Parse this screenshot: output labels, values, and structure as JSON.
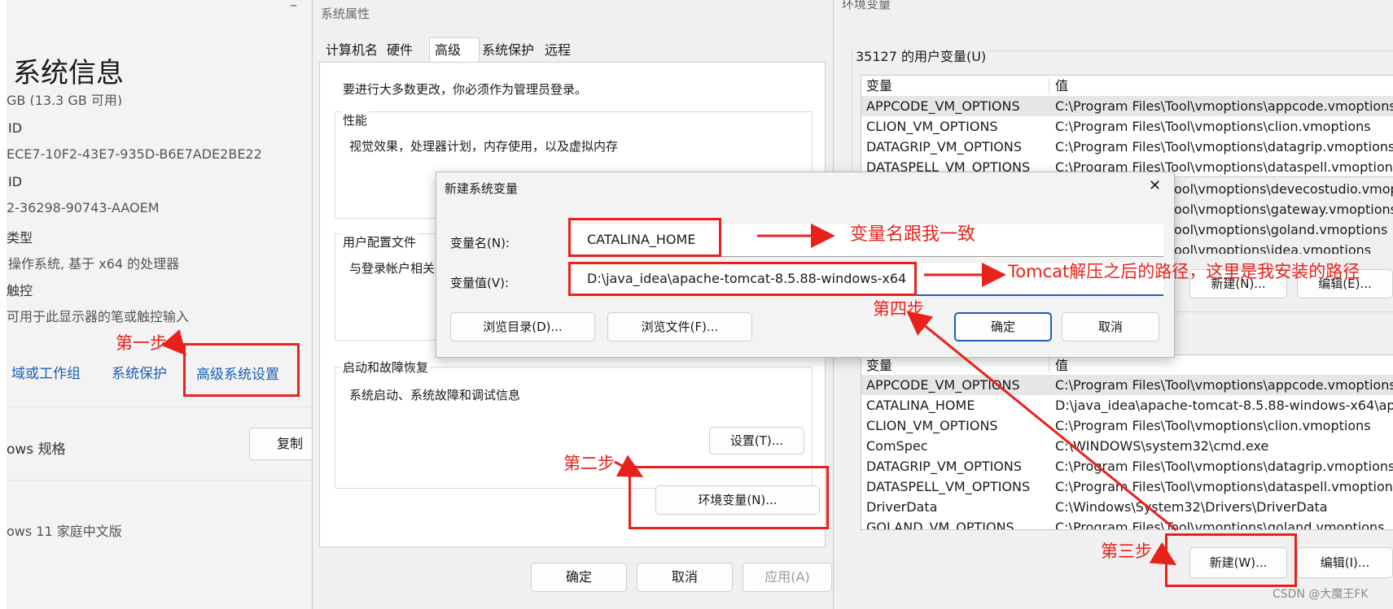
{
  "settings": {
    "title": "系统信息",
    "minimize_glyph": "–",
    "lines": [
      "GB (13.3 GB 可用)",
      "ID",
      "ECE7-10F2-43E7-935D-B6E7ADE2BE22",
      "ID",
      "2-36298-90743-AAOEM",
      "类型",
      "操作系统, 基于 x64 的处理器",
      "触控",
      "可用于此显示器的笔或触控输入"
    ],
    "links": [
      "域或工作组",
      "系统保护",
      "高级系统设置"
    ],
    "spec_label": "ows 规格",
    "copy_button": "复制",
    "edition": "ows 11 家庭中文版"
  },
  "sysprops": {
    "title": "系统属性",
    "tabs": [
      "计算机名",
      "硬件",
      "高级",
      "系统保护",
      "远程"
    ],
    "admin_note": "要进行大多数更改，你必须作为管理员登录。",
    "perf_title": "性能",
    "perf_desc": "视觉效果，处理器计划，内存使用，以及虚拟内存",
    "profile_title": "用户配置文件",
    "profile_desc": "与登录帐户相关",
    "startup_title": "启动和故障恢复",
    "startup_desc": "系统启动、系统故障和调试信息",
    "settings_button": "设置(T)...",
    "env_button": "环境变量(N)...",
    "ok": "确定",
    "cancel": "取消",
    "apply": "应用(A)"
  },
  "envwin": {
    "title": "环境变量",
    "user_vars_title": "35127 的用户变量(U)",
    "col_var": "变量",
    "col_val": "值",
    "user_vars": [
      {
        "name": "APPCODE_VM_OPTIONS",
        "value": "C:\\Program Files\\Tool\\vmoptions\\appcode.vmoptions"
      },
      {
        "name": "CLION_VM_OPTIONS",
        "value": "C:\\Program Files\\Tool\\vmoptions\\clion.vmoptions"
      },
      {
        "name": "DATAGRIP_VM_OPTIONS",
        "value": "C:\\Program Files\\Tool\\vmoptions\\datagrip.vmoptions"
      },
      {
        "name": "DATASPELL_VM_OPTIONS",
        "value": "C:\\Program Files\\Tool\\vmoptions\\dataspell.vmoptions"
      },
      {
        "name": "",
        "value": "ool\\vmoptions\\devecostudio.vmopt"
      },
      {
        "name": "",
        "value": "ool\\vmoptions\\gateway.vmoptions"
      },
      {
        "name": "",
        "value": "ool\\vmoptions\\goland.vmoptions"
      },
      {
        "name": "",
        "value": "ool\\vmoptions\\idea.vmoptions"
      }
    ],
    "user_new": "新建(N)...",
    "user_edit": "编辑(E)...",
    "sys_vars": [
      {
        "name": "APPCODE_VM_OPTIONS",
        "value": "C:\\Program Files\\Tool\\vmoptions\\appcode.vmoptions"
      },
      {
        "name": "CATALINA_HOME",
        "value": "D:\\java_idea\\apache-tomcat-8.5.88-windows-x64\\apa"
      },
      {
        "name": "CLION_VM_OPTIONS",
        "value": "C:\\Program Files\\Tool\\vmoptions\\clion.vmoptions"
      },
      {
        "name": "ComSpec",
        "value": "C:\\WINDOWS\\system32\\cmd.exe"
      },
      {
        "name": "DATAGRIP_VM_OPTIONS",
        "value": "C:\\Program Files\\Tool\\vmoptions\\datagrip.vmoptions"
      },
      {
        "name": "DATASPELL_VM_OPTIONS",
        "value": "C:\\Program Files\\Tool\\vmoptions\\dataspell.vmoptions"
      },
      {
        "name": "DriverData",
        "value": "C:\\Windows\\System32\\Drivers\\DriverData"
      },
      {
        "name": "GOLAND_VM_OPTIONS",
        "value": "C:\\Program Files\\Tool\\vmoptions\\goland.vmoptions"
      }
    ],
    "sys_new": "新建(W)...",
    "sys_edit": "编辑(I)..."
  },
  "dialog": {
    "title": "新建系统变量",
    "close_glyph": "✕",
    "name_label": "变量名(N):",
    "name_value": "CATALINA_HOME",
    "value_label": "变量值(V):",
    "value_value": "D:\\java_idea\\apache-tomcat-8.5.88-windows-x64",
    "browse_dir": "浏览目录(D)...",
    "browse_file": "浏览文件(F)...",
    "ok": "确定",
    "cancel": "取消"
  },
  "annotations": {
    "step1": "第一步",
    "step2": "第二步",
    "step3": "第三步",
    "step4": "第四步",
    "note_name": "变量名跟我一致",
    "note_path": "Tomcat解压之后的路径，这里是我安装的路径",
    "color": "#e8221b"
  },
  "watermark": "CSDN @大魔王FK"
}
